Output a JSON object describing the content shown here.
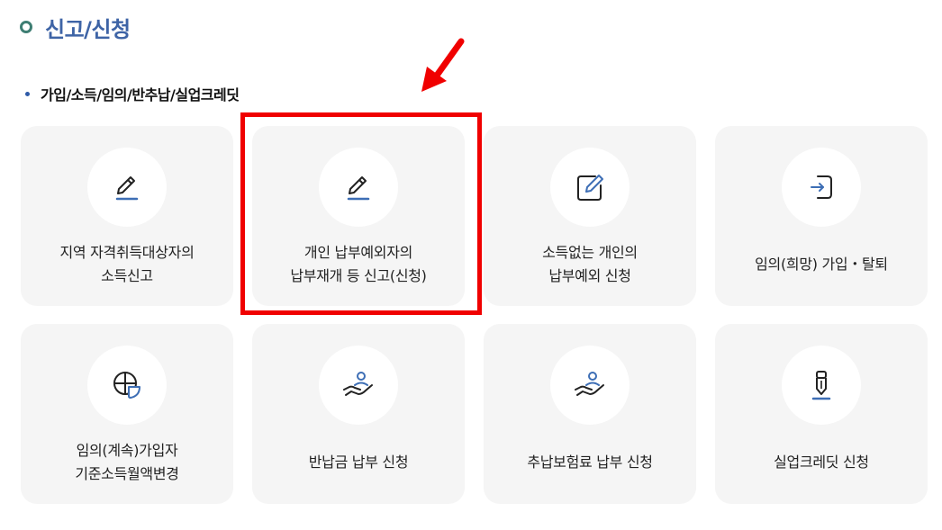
{
  "page": {
    "title": "신고/신청",
    "section_title": "가입/소득/임의/반추납/실업크레딧"
  },
  "cards": [
    {
      "label": "지역 자격취득대상자의\n소득신고",
      "icon": "pen-icon"
    },
    {
      "label": "개인 납부예외자의\n납부재개 등 신고(신청)",
      "icon": "pen-icon"
    },
    {
      "label": "소득없는 개인의\n납부예외 신청",
      "icon": "edit-box-icon"
    },
    {
      "label": "임의(희망) 가입・탈퇴",
      "icon": "login-icon"
    },
    {
      "label": "임의(계속)가입자\n기준소득월액변경",
      "icon": "pie-chart-icon"
    },
    {
      "label": "반납금 납부 신청",
      "icon": "hand-person-icon"
    },
    {
      "label": "추납보험료 납부 신청",
      "icon": "hand-person-icon"
    },
    {
      "label": "실업크레딧 신청",
      "icon": "pencil-icon"
    }
  ],
  "annotation": {
    "highlighted_card": 1,
    "highlight_color": "#f00000"
  },
  "colors": {
    "title": "#3e64a6",
    "icon_accent": "#3d6eb5",
    "card_background": "#f5f5f5"
  }
}
